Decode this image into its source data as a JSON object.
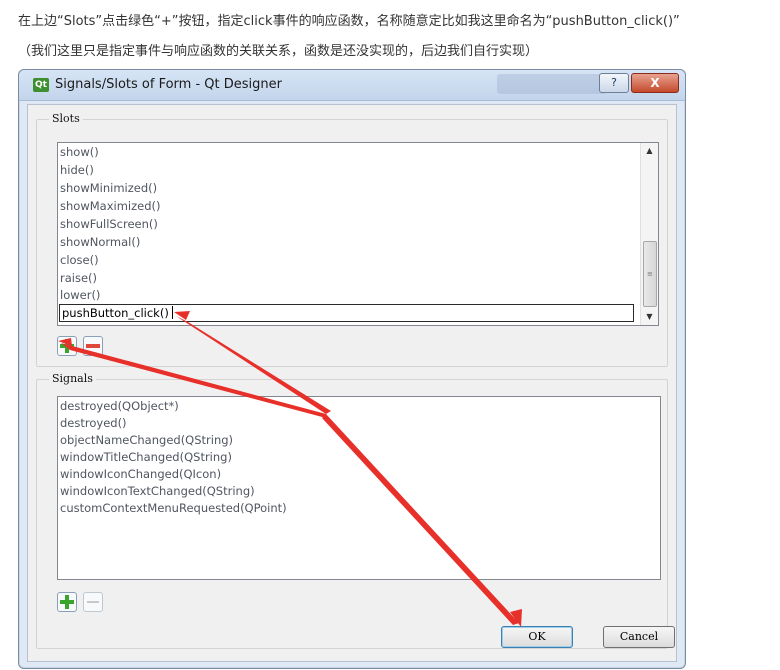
{
  "captions": {
    "line1": "在上边“Slots”点击绿色“+”按钮，指定click事件的响应函数，名称随意定比如我这里命名为“pushButton_click()”",
    "line2": "（我们这里只是指定事件与响应函数的关联关系，函数是还没实现的，后边我们自行实现）"
  },
  "dialog": {
    "title": "Signals/Slots of Form - Qt Designer",
    "help_label": "?",
    "close_label": "X",
    "ok_label": "OK",
    "cancel_label": "Cancel"
  },
  "slots": {
    "group_title": "Slots",
    "items": [
      "show()",
      "hide()",
      "showMinimized()",
      "showMaximized()",
      "showFullScreen()",
      "showNormal()",
      "close()",
      "raise()",
      "lower()"
    ],
    "editing_value": "pushButton_click()"
  },
  "signals": {
    "group_title": "Signals",
    "items": [
      "destroyed(QObject*)",
      "destroyed()",
      "objectNameChanged(QString)",
      "windowTitleChanged(QString)",
      "windowIconChanged(QIcon)",
      "windowIconTextChanged(QString)",
      "customContextMenuRequested(QPoint)"
    ]
  },
  "icons": {
    "add": "plus-icon",
    "remove": "minus-icon",
    "app": "qt-designer-icon",
    "annotation": "red-arrow-icon"
  },
  "colors": {
    "add_green": "#39a52a",
    "remove_red": "#e0473c",
    "annotation_red": "#e8302a"
  }
}
